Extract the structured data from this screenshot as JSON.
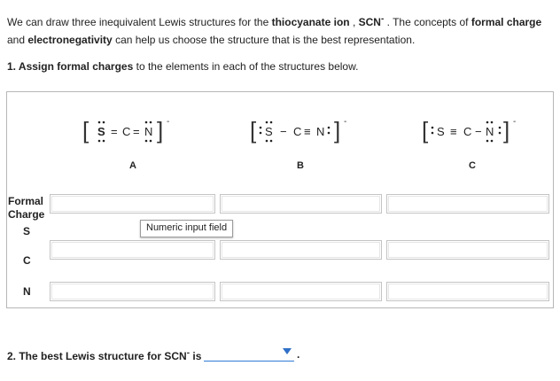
{
  "intro": {
    "p1": "We can draw three inequivalent Lewis structures for the ",
    "ion_name": "thiocyanate ion",
    "comma": " , ",
    "formula": "SCN",
    "charge": "-",
    "p2": " . The concepts of ",
    "fc": "formal charge",
    "and": " and ",
    "en": "electronegativity",
    "p3": " can help us choose the structure that is the best representation."
  },
  "q1": {
    "number": "1. ",
    "bold": "Assign formal charges",
    "rest": " to the elements in each of the structures below."
  },
  "structures": [
    {
      "caption": "A",
      "atoms": [
        "S",
        "C",
        "N"
      ],
      "bonds": [
        "=",
        "="
      ]
    },
    {
      "caption": "B",
      "atoms": [
        "S",
        "C",
        "N"
      ],
      "bonds": [
        "−",
        "≡"
      ]
    },
    {
      "caption": "C",
      "atoms": [
        "S",
        "C",
        "N"
      ],
      "bonds": [
        "≡",
        "−"
      ]
    }
  ],
  "ion_charge": "-",
  "row_labels": {
    "header": "Formal Charge",
    "s": "S",
    "c": "C",
    "n": "N"
  },
  "tooltip": "Numeric input field",
  "q2": {
    "text": "2. The best Lewis structure for SCN",
    "sup": "-",
    "tail": " is",
    "selected": "",
    "period": "."
  }
}
